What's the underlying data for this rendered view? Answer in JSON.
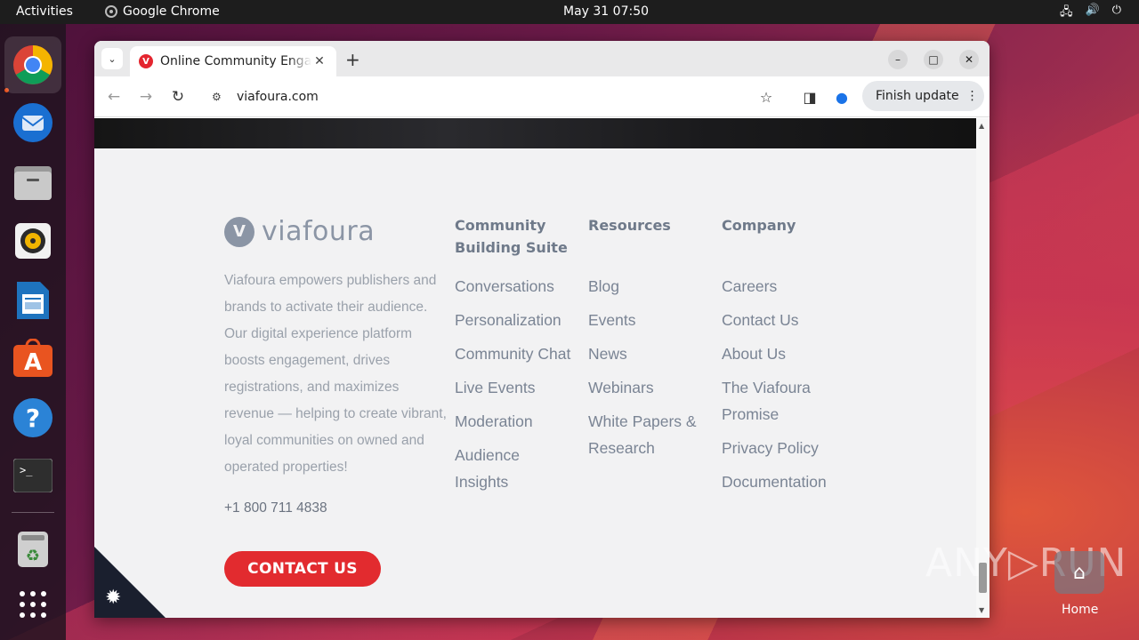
{
  "topbar": {
    "activities": "Activities",
    "app_name": "Google Chrome",
    "clock": "May 31  07:50"
  },
  "dock": {
    "apps": [
      "chrome-icon",
      "thunderbird-icon",
      "files-icon",
      "rhythmbox-icon",
      "libreoffice-writer-icon",
      "app-center-icon",
      "help-icon",
      "terminal-icon",
      "trash-icon",
      "show-apps-icon"
    ]
  },
  "browser": {
    "tab_title": "Online Community Engagement",
    "url": "viafoura.com",
    "finish_update": "Finish update"
  },
  "footer": {
    "logo_text": "viafoura",
    "about": "Viafoura empowers publishers and brands to activate their audience. Our digital experience platform boosts engagement, drives registrations, and maximizes revenue — helping to create vibrant, loyal communities on owned and operated properties!",
    "phone": "+1 800 711 4838",
    "contact_button": "CONTACT US",
    "columns": [
      {
        "heading": "Community Building Suite",
        "links": [
          "Conversations",
          "Personalization",
          "Community Chat",
          "Live Events",
          "Moderation",
          "Audience Insights"
        ]
      },
      {
        "heading": "Resources",
        "links": [
          "Blog",
          "Events",
          "News",
          "Webinars",
          "White Papers & Research"
        ]
      },
      {
        "heading": "Company",
        "links": [
          "Careers",
          "Contact Us",
          "About Us",
          "The Viafoura Promise",
          "Privacy Policy",
          "Documentation"
        ]
      }
    ]
  },
  "desktop": {
    "watermark": "ANY▷RUN",
    "home_label": "Home"
  },
  "colors": {
    "accent_red": "#e22b2f",
    "footer_bg": "#f2f2f3",
    "ubuntu_orange": "#e95420"
  }
}
